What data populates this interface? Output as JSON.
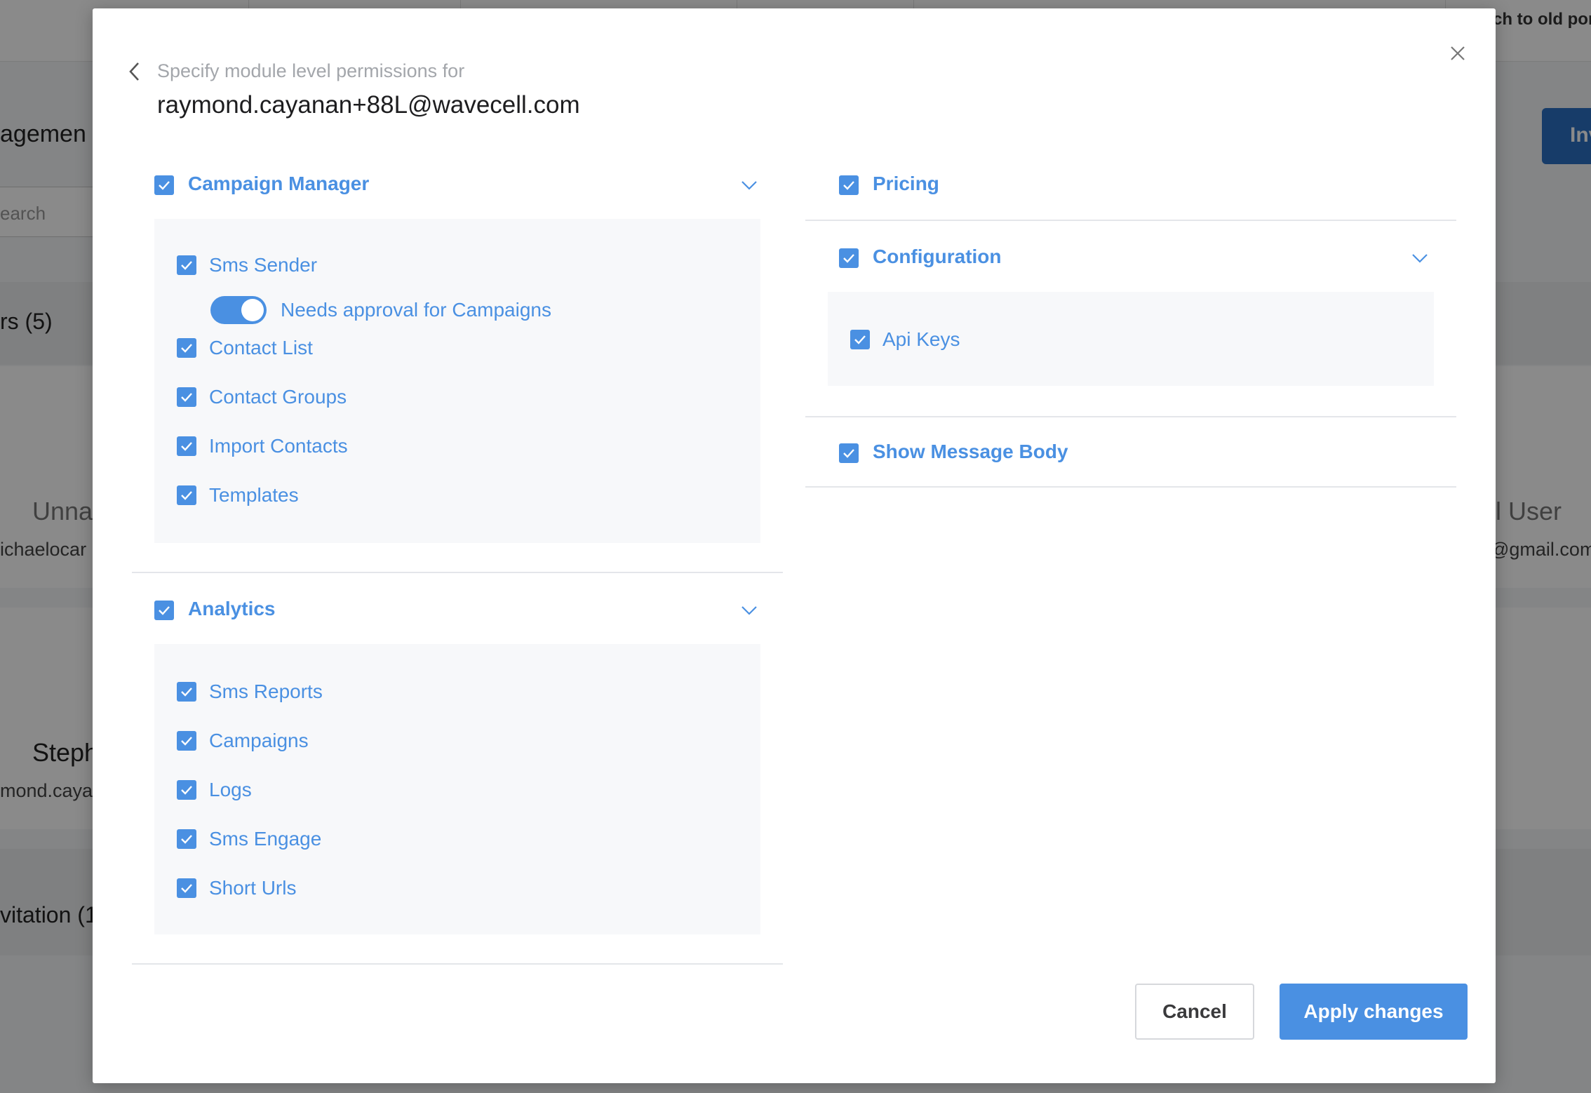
{
  "background": {
    "switch_link": "tch to old por",
    "page_title": "agemen",
    "invite_button": "Inv",
    "search_placeholder": "earch",
    "users_tab": "rs (5)",
    "card1_name_left": "Unna",
    "card1_email_left": "ichaelocar",
    "card1_name_right": "l User",
    "card1_email_right": "@gmail.com",
    "card2_name": "Steph",
    "card2_email": "mond.caya",
    "invitations_tab": "vitation (1"
  },
  "modal": {
    "subtitle": "Specify module level permissions for",
    "email": "raymond.cayanan+88L@wavecell.com",
    "campaign_manager": {
      "title": "Campaign Manager",
      "checked": true,
      "items": [
        {
          "label": "Sms Sender",
          "checked": true
        },
        {
          "label": "Contact List",
          "checked": true
        },
        {
          "label": "Contact Groups",
          "checked": true
        },
        {
          "label": "Import Contacts",
          "checked": true
        },
        {
          "label": "Templates",
          "checked": true
        }
      ],
      "toggle_label": "Needs approval for Campaigns",
      "toggle_on": true
    },
    "analytics": {
      "title": "Analytics",
      "checked": true,
      "items": [
        {
          "label": "Sms Reports",
          "checked": true
        },
        {
          "label": "Campaigns",
          "checked": true
        },
        {
          "label": "Logs",
          "checked": true
        },
        {
          "label": "Sms Engage",
          "checked": true
        },
        {
          "label": "Short Urls",
          "checked": true
        }
      ]
    },
    "pricing": {
      "title": "Pricing",
      "checked": true
    },
    "configuration": {
      "title": "Configuration",
      "checked": true,
      "items": [
        {
          "label": "Api Keys",
          "checked": true
        }
      ]
    },
    "show_message_body": {
      "title": "Show Message Body",
      "checked": true
    },
    "cancel_label": "Cancel",
    "apply_label": "Apply changes"
  },
  "colors": {
    "accent": "#4a90e2",
    "overlay": "rgba(0,0,0,0.46)",
    "panel_bg": "#f7f8fa"
  }
}
